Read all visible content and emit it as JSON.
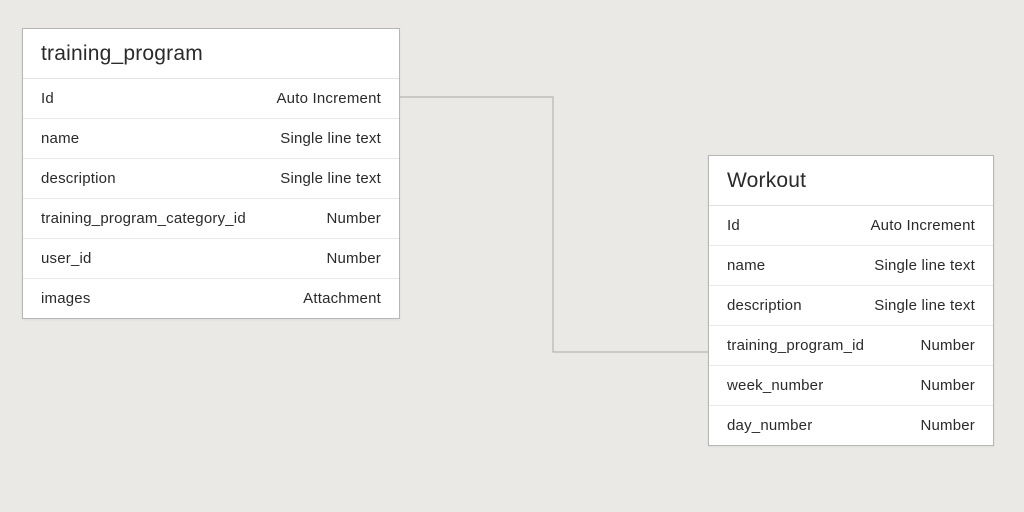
{
  "entities": [
    {
      "title": "training_program",
      "fields": [
        {
          "name": "Id",
          "type": "Auto Increment"
        },
        {
          "name": "name",
          "type": "Single line text"
        },
        {
          "name": "description",
          "type": "Single line text"
        },
        {
          "name": "training_program_category_id",
          "type": "Number"
        },
        {
          "name": "user_id",
          "type": "Number"
        },
        {
          "name": "images",
          "type": "Attachment"
        }
      ]
    },
    {
      "title": "Workout",
      "fields": [
        {
          "name": "Id",
          "type": "Auto Increment"
        },
        {
          "name": "name",
          "type": "Single line text"
        },
        {
          "name": "description",
          "type": "Single line text"
        },
        {
          "name": "training_program_id",
          "type": "Number"
        },
        {
          "name": "week_number",
          "type": "Number"
        },
        {
          "name": "day_number",
          "type": "Number"
        }
      ]
    }
  ],
  "relationship": {
    "from_entity": "training_program",
    "from_field": "Id",
    "to_entity": "Workout",
    "to_field": "training_program_id"
  }
}
